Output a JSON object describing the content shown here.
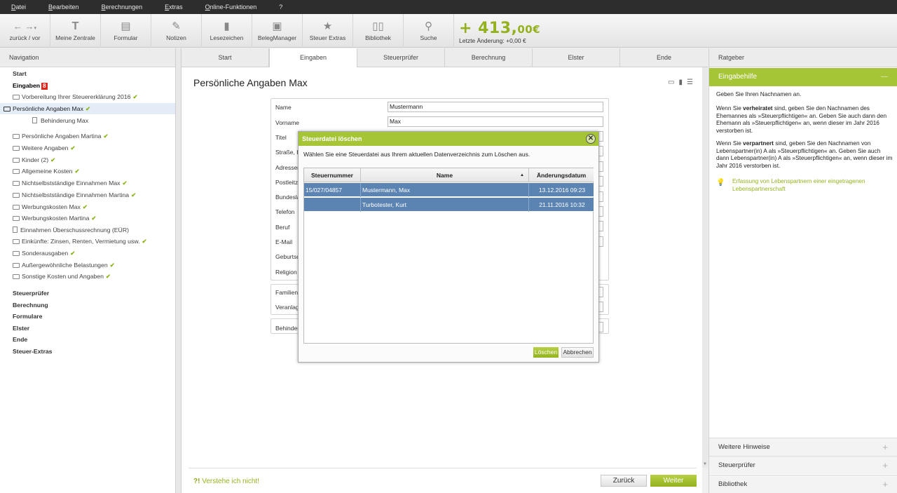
{
  "menu": [
    "Datei",
    "Bearbeiten",
    "Berechnungen",
    "Extras",
    "Online-Funktionen",
    "?"
  ],
  "toolbar": {
    "back_label": "zurück / vor",
    "items": [
      {
        "label": "Meine Zentrale",
        "icon": "T"
      },
      {
        "label": "Formular",
        "icon": "form-icon"
      },
      {
        "label": "Notizen",
        "icon": "pencil-icon"
      },
      {
        "label": "Lesezeichen",
        "icon": "bookmark-icon"
      },
      {
        "label": "BelegManager",
        "icon": "receipt-icon"
      },
      {
        "label": "Steuer Extras",
        "icon": "star-icon"
      },
      {
        "label": "Bibliothek",
        "icon": "book-icon"
      },
      {
        "label": "Suche",
        "icon": "search-icon"
      }
    ],
    "refund_main": "+ 413,",
    "refund_cents": "00€",
    "refund_sub": "Letzte Änderung: +0,00 €"
  },
  "navigation": {
    "header": "Navigation",
    "start": "Start",
    "eingaben": "Eingaben",
    "eingaben_badge": "8",
    "items": [
      "Vorbereitung Ihrer Steuererklärung 2016",
      "Persönliche Angaben Max",
      "Behinderung Max",
      "Persönliche Angaben Martina",
      "Weitere Angaben",
      "Kinder (2)",
      "Allgemeine Kosten",
      "Nichtselbstständige Einnahmen Max",
      "Nichtselbstständige Einnahmen Martina",
      "Werbungskosten Max",
      "Werbungskosten Martina",
      "Einnahmen Überschussrechnung (EÜR)",
      "Einkünfte: Zinsen, Renten, Vermietung usw.",
      "Sonderausgaben",
      "Außergewöhnliche Belastungen",
      "Sonstige Kosten und Angaben"
    ],
    "sections": [
      "Steuerprüfer",
      "Berechnung",
      "Formulare",
      "Elster",
      "Ende",
      "Steuer-Extras"
    ]
  },
  "tabs": [
    "Start",
    "Eingaben",
    "Steuerprüfer",
    "Berechnung",
    "Elster",
    "Ende"
  ],
  "page": {
    "title": "Persönliche Angaben Max",
    "fields": [
      {
        "label": "Name",
        "value": "Mustermann"
      },
      {
        "label": "Vorname",
        "value": "Max"
      },
      {
        "label": "Titel",
        "value": ""
      },
      {
        "label": "Straße, H",
        "value": ""
      },
      {
        "label": "Adressergä",
        "value": ""
      },
      {
        "label": "Postleitza",
        "value": ""
      },
      {
        "label": "Bundeslan",
        "value": ""
      },
      {
        "label": "Telefon",
        "value": ""
      },
      {
        "label": "Beruf",
        "value": ""
      },
      {
        "label": "E-Mail",
        "value": ""
      },
      {
        "label": "Geburtsda",
        "value": ""
      },
      {
        "label": "Religion",
        "value": ""
      },
      {
        "label": "Familienst",
        "value": ""
      },
      {
        "label": "Veranlagu",
        "value": ""
      },
      {
        "label": "Behinder",
        "value": ""
      }
    ],
    "verstehe_mark": "?!",
    "verstehe": "Verstehe ich nicht!",
    "btn_back": "Zurück",
    "btn_next": "Weiter"
  },
  "ratgeber": {
    "header": "Ratgeber",
    "eingabehilfe": "Eingabehilfe",
    "p1": "Geben Sie Ihren Nachnamen an.",
    "p2_pre": "Wenn Sie ",
    "p2_bold": "verheiratet",
    "p2_post": " sind, geben Sie den Nachnamen des Ehemannes als »Steuerpflichtigen« an. Geben Sie auch dann den Ehemann als »Steuerpflichtigen« an, wenn dieser im Jahr 2016 verstorben ist.",
    "p3_pre": "Wenn Sie ",
    "p3_bold": "verpartnert",
    "p3_post": " sind, geben Sie den Nachnamen von Lebenspartner(in) A als »Steuerpflichtigen« an. Geben Sie auch dann Lebenspartner(in) A als »Steuerpflichtigen« an, wenn dieser im Jahr 2016 verstorben ist.",
    "link": "Erfassung von Lebenspartnern einer eingetragenen Lebenspartnerschaft",
    "accordions": [
      "Weitere Hinweise",
      "Steuerprüfer",
      "Bibliothek"
    ]
  },
  "dialog": {
    "title": "Steuerdatei löschen",
    "text": "Wählen Sie eine Steuerdatei aus Ihrem aktuellen Datenverzeichnis zum Löschen aus.",
    "columns": [
      "Steuernummer",
      "Name",
      "Änderungsdatum"
    ],
    "rows": [
      {
        "nummer": "15/027/04857",
        "name": "Mustermann, Max",
        "datum": "13.12.2016 09:23"
      },
      {
        "nummer": "",
        "name": "Turbotester, Kurt",
        "datum": "21.11.2016 10:32"
      }
    ],
    "btn_delete": "Löschen",
    "btn_cancel": "Abbrechen"
  }
}
